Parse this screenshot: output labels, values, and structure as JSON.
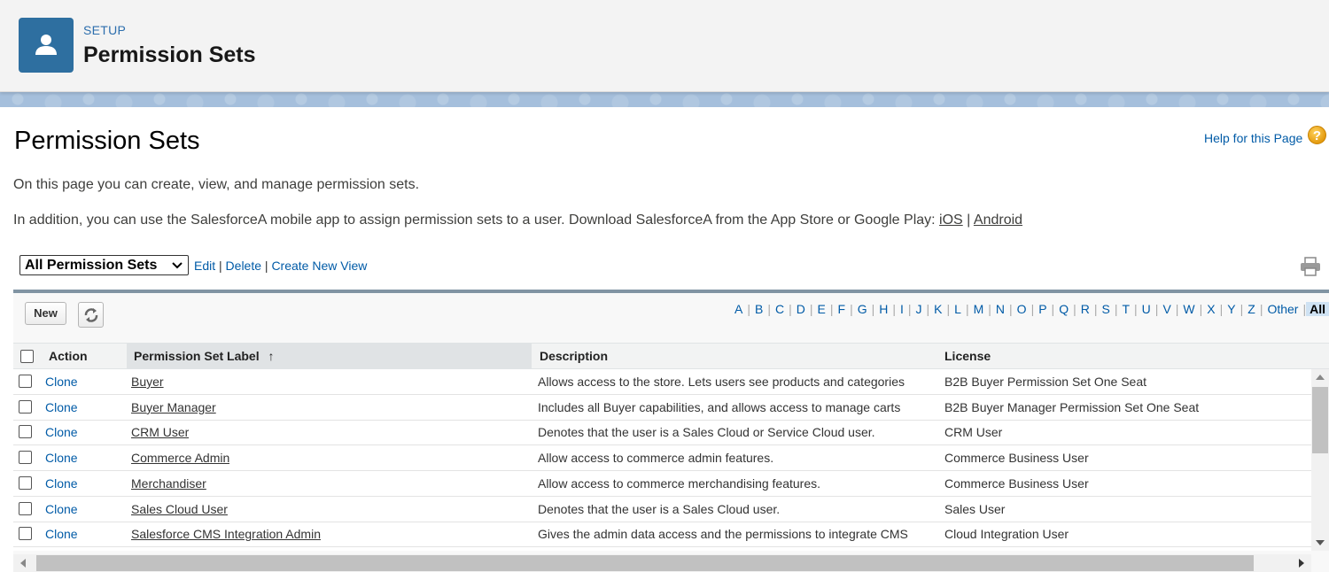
{
  "header": {
    "eyebrow": "SETUP",
    "title": "Permission Sets",
    "icon": "user-icon",
    "icon_bg": "#2e6fa0"
  },
  "page": {
    "title": "Permission Sets",
    "help_link": "Help for this Page",
    "intro_1": "On this page you can create, view, and manage permission sets.",
    "intro_2_text": "In addition, you can use the SalesforceA mobile app to assign permission sets to a user. Download SalesforceA from the App Store or Google Play:",
    "intro_2_ios": "iOS",
    "intro_2_sep": "|",
    "intro_2_android": "Android"
  },
  "view": {
    "selected": "All Permission Sets",
    "edit": "Edit",
    "delete": "Delete",
    "create_new_view": "Create New View"
  },
  "toolbar": {
    "new_label": "New",
    "alphabet": [
      "A",
      "B",
      "C",
      "D",
      "E",
      "F",
      "G",
      "H",
      "I",
      "J",
      "K",
      "L",
      "M",
      "N",
      "O",
      "P",
      "Q",
      "R",
      "S",
      "T",
      "U",
      "V",
      "W",
      "X",
      "Y",
      "Z",
      "Other",
      "All"
    ],
    "alphabet_active": "All"
  },
  "table": {
    "columns": {
      "action": "Action",
      "label": "Permission Set Label",
      "sort_indicator": "↑",
      "description": "Description",
      "license": "License"
    },
    "rows": [
      {
        "action": "Clone",
        "label": "Buyer",
        "description": "Allows access to the store. Lets users see products and categories",
        "license": "B2B Buyer Permission Set One Seat"
      },
      {
        "action": "Clone",
        "label": "Buyer Manager",
        "description": "Includes all Buyer capabilities, and allows access to manage carts",
        "license": "B2B Buyer Manager Permission Set One Seat"
      },
      {
        "action": "Clone",
        "label": "CRM User",
        "description": "Denotes that the user is a Sales Cloud or Service Cloud user.",
        "license": "CRM User"
      },
      {
        "action": "Clone",
        "label": "Commerce Admin",
        "description": "Allow access to commerce admin features.",
        "license": "Commerce Business User"
      },
      {
        "action": "Clone",
        "label": "Merchandiser",
        "description": "Allow access to commerce merchandising features.",
        "license": "Commerce Business User"
      },
      {
        "action": "Clone",
        "label": "Sales Cloud User",
        "description": "Denotes that the user is a Sales Cloud user.",
        "license": "Sales User"
      },
      {
        "action": "Clone",
        "label": "Salesforce CMS Integration Admin",
        "description": "Gives the admin data access and the permissions to integrate CMS",
        "license": "Cloud Integration User"
      }
    ]
  }
}
